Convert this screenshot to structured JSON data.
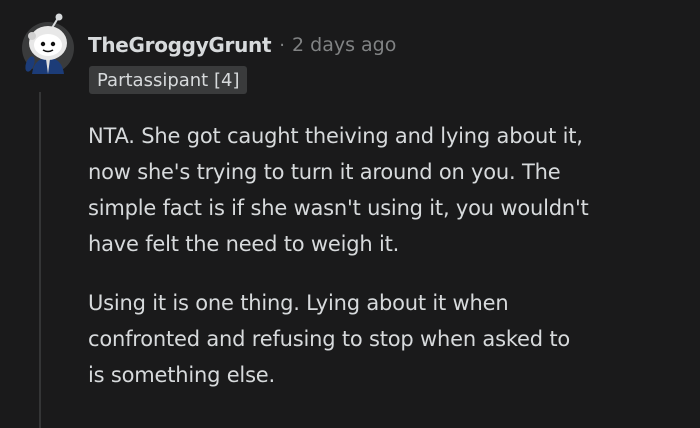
{
  "comment": {
    "username": "TheGroggyGrunt",
    "separator": "·",
    "timestamp": "2 days ago",
    "flair": "Partassipant [4]",
    "paragraphs": [
      {
        "lines": [
          "NTA. She got caught theiving and lying about it,",
          "now she's trying to turn it around on you. The",
          "simple fact is if she wasn't using it, you wouldn't",
          "have felt the need to weigh it."
        ]
      },
      {
        "lines": [
          "Using it is one thing. Lying about it when",
          "confronted and refusing to stop when asked to",
          "is something else."
        ]
      }
    ]
  },
  "icons": {
    "avatar": "snoo-avatar-icon"
  },
  "colors": {
    "background": "#1a1a1b",
    "text": "#d7dadc",
    "meta": "#818384",
    "flair_bg": "#3a3b3c",
    "thread_line": "#343536"
  }
}
